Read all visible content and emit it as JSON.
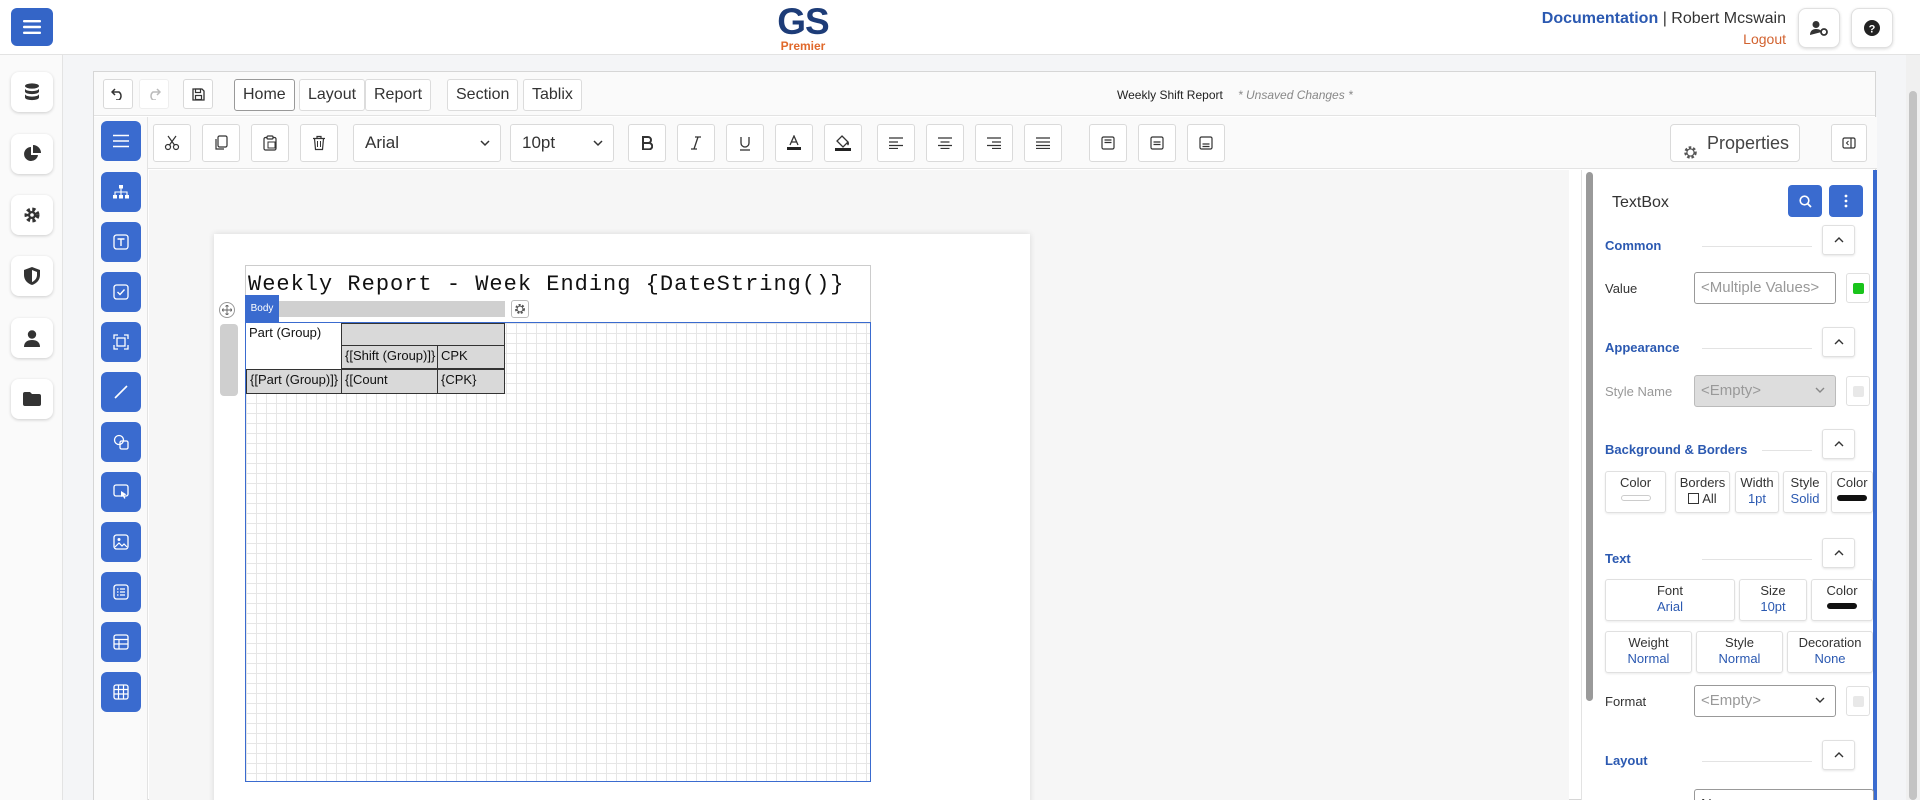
{
  "app": {
    "logo_main": "GS",
    "logo_sub": "Premier",
    "documentation_link": "Documentation",
    "separator": "|",
    "user_name": "Robert Mcswain",
    "logout_label": "Logout"
  },
  "designer": {
    "tabs": [
      "Home",
      "Layout",
      "Report",
      "Section",
      "Tablix"
    ],
    "document_title": "Weekly Shift Report",
    "unsaved_label": "* Unsaved Changes *",
    "font_family": "Arial",
    "font_size": "10pt",
    "properties_label": "Properties"
  },
  "canvas": {
    "report_title": "Weekly Report - Week Ending {DateString()}",
    "body_label": "Body",
    "tablix": {
      "header_corner": "Part (Group)",
      "shift_header": "{[Shift (Group)]}",
      "cpk_header": "CPK",
      "row_part": "{[Part (Group)]}",
      "row_count": "{[Count",
      "row_cpk": "{CPK}"
    }
  },
  "properties": {
    "title": "TextBox",
    "sections": {
      "common": "Common",
      "appearance": "Appearance",
      "background_borders": "Background & Borders",
      "text": "Text",
      "layout": "Layout"
    },
    "value_label": "Value",
    "value_placeholder": "<Multiple Values>",
    "style_name_label": "Style Name",
    "style_name_value": "<Empty>",
    "bg": {
      "color_label": "Color",
      "borders_label": "Borders",
      "borders_all": "All",
      "width_label": "Width",
      "width_value": "1pt",
      "style_label": "Style",
      "style_value": "Solid",
      "color2_label": "Color"
    },
    "text": {
      "font_label": "Font",
      "font_value": "Arial",
      "size_label": "Size",
      "size_value": "10pt",
      "color_label": "Color",
      "weight_label": "Weight",
      "weight_value": "Normal",
      "style_label": "Style",
      "style_value": "Normal",
      "decoration_label": "Decoration",
      "decoration_value": "None",
      "format_label": "Format",
      "format_value": "<Empty>"
    },
    "layout_value": "None"
  },
  "colors": {
    "primary": "#3a6bcf",
    "brand_navy": "#1d3c78",
    "brand_orange": "#e0682a",
    "value_green": "#19c41b"
  }
}
